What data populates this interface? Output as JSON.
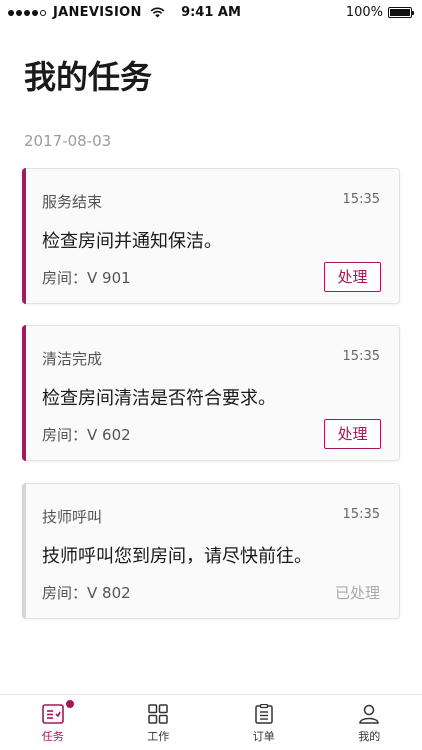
{
  "status_bar": {
    "carrier": "JANEVISION",
    "time": "9:41 AM",
    "battery": "100%"
  },
  "page_title": "我的任务",
  "date": "2017-08-03",
  "accent_color": "#a3195b",
  "muted_bar_color": "#d6d6d6",
  "tasks": [
    {
      "type": "服务结束",
      "time": "15:35",
      "message": "检查房间并通知保洁。",
      "room": "房间：V 901",
      "action": "处理",
      "status": "pending"
    },
    {
      "type": "清洁完成",
      "time": "15:35",
      "message": "检查房间清洁是否符合要求。",
      "room": "房间：V 602",
      "action": "处理",
      "status": "pending"
    },
    {
      "type": "技师呼叫",
      "time": "15:35",
      "message": "技师呼叫您到房间，请尽快前往。",
      "room": "房间：V 802",
      "action": "已处理",
      "status": "handled"
    }
  ],
  "tab_bar": {
    "tabs": [
      {
        "label": "任务",
        "icon": "task-icon",
        "active": true,
        "has_badge": true
      },
      {
        "label": "工作",
        "icon": "grid-icon",
        "active": false
      },
      {
        "label": "订单",
        "icon": "clipboard-icon",
        "active": false
      },
      {
        "label": "我的",
        "icon": "user-icon",
        "active": false
      }
    ]
  }
}
